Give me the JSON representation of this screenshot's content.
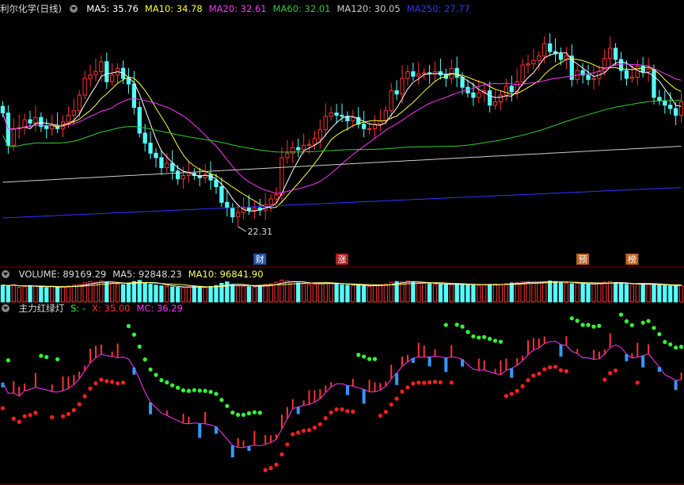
{
  "main_legend": {
    "title": "利尔化学(日线)",
    "items": [
      {
        "label": "MA5: 35.76",
        "color": "#ffffff"
      },
      {
        "label": "MA10: 34.78",
        "color": "#ffff33"
      },
      {
        "label": "MA20: 32.61",
        "color": "#ff33ff"
      },
      {
        "label": "MA60: 32.01",
        "color": "#33cc33"
      },
      {
        "label": "MA120: 30.05",
        "color": "#cccccc"
      },
      {
        "label": "MA250: 27.77",
        "color": "#3333ff"
      }
    ]
  },
  "volume_legend": {
    "items": [
      {
        "label": "VOLUME: 89169.29",
        "color": "#dddddd"
      },
      {
        "label": "MA5: 92848.23",
        "color": "#dddddd"
      },
      {
        "label": "MA10: 96841.90",
        "color": "#ffff66"
      }
    ]
  },
  "indicator_legend": {
    "items": [
      {
        "label": "主力红绿灯",
        "color": "#dddddd"
      },
      {
        "label": "S: -",
        "color": "#33ff33"
      },
      {
        "label": "X: 35.00",
        "color": "#ff3333"
      },
      {
        "label": "MC: 36.29",
        "color": "#ff33ff"
      }
    ]
  },
  "colors": {
    "up": "#ff3232",
    "down": "#54ffff",
    "grid": "#7a0000",
    "ma5": "#ffffff",
    "ma10": "#ffff33",
    "ma20": "#ff33ff",
    "ma60": "#33cc33",
    "ma120": "#cccccc",
    "ma250": "#3333ff"
  },
  "chart_data": {
    "type": "candlestick",
    "x": [
      "1",
      "2",
      "3",
      "4",
      "5",
      "6",
      "7",
      "8",
      "9",
      "10",
      "11",
      "12",
      "13",
      "14",
      "15",
      "16",
      "17",
      "18",
      "19",
      "20",
      "21",
      "22",
      "23",
      "24",
      "25",
      "26",
      "27",
      "28",
      "29",
      "30",
      "31",
      "32",
      "33",
      "34",
      "35",
      "36",
      "37",
      "38",
      "39",
      "40",
      "41",
      "42",
      "43",
      "44",
      "45",
      "46",
      "47",
      "48",
      "49",
      "50",
      "51",
      "52",
      "53",
      "54",
      "55",
      "56",
      "57",
      "58",
      "59",
      "60",
      "61",
      "62",
      "63",
      "64",
      "65",
      "66",
      "67",
      "68",
      "69",
      "70",
      "71",
      "72",
      "73",
      "74",
      "75",
      "76",
      "77",
      "78",
      "79",
      "80",
      "81",
      "82",
      "83",
      "84",
      "85",
      "86",
      "87",
      "88",
      "89",
      "90",
      "91",
      "92",
      "93",
      "94",
      "95",
      "96",
      "97",
      "98",
      "99",
      "100",
      "101",
      "102",
      "103",
      "104",
      "105",
      "106",
      "107",
      "108",
      "109",
      "110",
      "111",
      "112",
      "113",
      "114",
      "115",
      "116",
      "117",
      "118",
      "119",
      "120",
      "121",
      "122",
      "123",
      "124",
      "125"
    ],
    "open": [
      35.4,
      34.8,
      31.9,
      33.4,
      33.5,
      34.2,
      33.9,
      34.4,
      33.6,
      33.4,
      33.7,
      33.4,
      34.0,
      34.6,
      35.0,
      36.4,
      37.9,
      38.2,
      38.5,
      39.4,
      37.6,
      38.2,
      38.8,
      37.9,
      37.4,
      35.3,
      33.0,
      32.1,
      31.2,
      30.8,
      29.9,
      30.3,
      29.6,
      28.9,
      29.2,
      29.4,
      29.2,
      29.0,
      29.3,
      28.8,
      28.2,
      26.8,
      26.3,
      25.5,
      25.9,
      26.3,
      26.1,
      26.3,
      26.1,
      26.6,
      27.1,
      27.5,
      30.8,
      31.2,
      31.7,
      31.5,
      31.9,
      32.0,
      32.5,
      33.3,
      34.5,
      34.8,
      34.6,
      34.5,
      34.1,
      34.4,
      33.8,
      33.4,
      33.4,
      33.8,
      34.1,
      35.0,
      36.8,
      36.5,
      37.9,
      38.5,
      38.1,
      38.3,
      38.4,
      38.3,
      38.5,
      38.2,
      37.9,
      38.8,
      38.0,
      37.1,
      36.6,
      36.2,
      36.6,
      36.8,
      35.5,
      35.8,
      36.4,
      37.2,
      36.7,
      37.6,
      39.1,
      39.2,
      39.5,
      39.9,
      41.0,
      40.3,
      40.1,
      39.6,
      39.9,
      37.8,
      38.6,
      38.2,
      37.8,
      37.9,
      38.5,
      39.7,
      40.6,
      39.6,
      38.6,
      37.9,
      38.0,
      39.0,
      38.5,
      38.7,
      36.2,
      35.9,
      35.5,
      35.2,
      34.6
    ],
    "close": [
      34.8,
      31.9,
      33.4,
      33.5,
      34.2,
      33.9,
      34.4,
      33.6,
      33.4,
      33.7,
      33.4,
      34.0,
      34.6,
      35.0,
      36.4,
      37.9,
      38.2,
      38.5,
      39.4,
      37.6,
      38.2,
      38.8,
      37.9,
      37.4,
      35.3,
      33.0,
      32.1,
      31.2,
      30.8,
      29.9,
      30.3,
      29.6,
      28.9,
      29.2,
      29.4,
      29.2,
      29.0,
      29.3,
      28.8,
      28.2,
      26.8,
      26.3,
      25.5,
      25.9,
      26.3,
      26.1,
      26.3,
      26.1,
      26.6,
      27.1,
      27.5,
      30.8,
      31.2,
      31.7,
      31.5,
      31.9,
      32.0,
      32.5,
      33.3,
      34.5,
      34.8,
      34.6,
      34.5,
      34.1,
      34.4,
      33.8,
      33.4,
      33.4,
      33.8,
      34.1,
      35.0,
      36.8,
      36.5,
      37.9,
      38.5,
      38.1,
      38.3,
      38.4,
      38.3,
      38.5,
      38.2,
      37.9,
      38.8,
      38.0,
      37.1,
      36.6,
      36.2,
      36.6,
      36.8,
      35.5,
      35.8,
      36.4,
      37.2,
      36.7,
      37.6,
      39.1,
      39.2,
      39.5,
      39.9,
      41.0,
      40.3,
      40.1,
      39.6,
      39.9,
      37.8,
      38.6,
      38.2,
      37.8,
      37.9,
      38.5,
      39.7,
      40.6,
      39.6,
      38.6,
      37.9,
      38.0,
      39.0,
      38.5,
      38.7,
      36.2,
      35.9,
      35.5,
      35.2,
      34.6,
      35.8
    ],
    "volume": [
      92,
      88,
      95,
      80,
      84,
      90,
      86,
      82,
      78,
      85,
      80,
      83,
      88,
      92,
      96,
      105,
      112,
      108,
      115,
      110,
      104,
      98,
      95,
      100,
      112,
      118,
      106,
      98,
      92,
      88,
      85,
      82,
      80,
      78,
      84,
      86,
      82,
      79,
      85,
      90,
      102,
      110,
      95,
      88,
      86,
      84,
      82,
      90,
      95,
      100,
      108,
      120,
      115,
      110,
      104,
      100,
      98,
      96,
      102,
      106,
      104,
      98,
      94,
      92,
      90,
      92,
      88,
      86,
      90,
      94,
      98,
      108,
      112,
      110,
      115,
      108,
      104,
      102,
      100,
      98,
      96,
      95,
      94,
      98,
      100,
      96,
      92,
      90,
      94,
      96,
      98,
      95,
      100,
      104,
      106,
      110,
      112,
      108,
      105,
      110,
      115,
      112,
      108,
      104,
      100,
      102,
      98,
      96,
      100,
      104,
      108,
      112,
      106,
      100,
      96,
      94,
      98,
      100,
      96,
      94,
      92,
      90,
      88,
      91,
      89
    ],
    "annotations": [
      "22.31",
      "财",
      "涨",
      "预",
      "榜"
    ],
    "ylim": [
      21.5,
      43.5
    ]
  }
}
